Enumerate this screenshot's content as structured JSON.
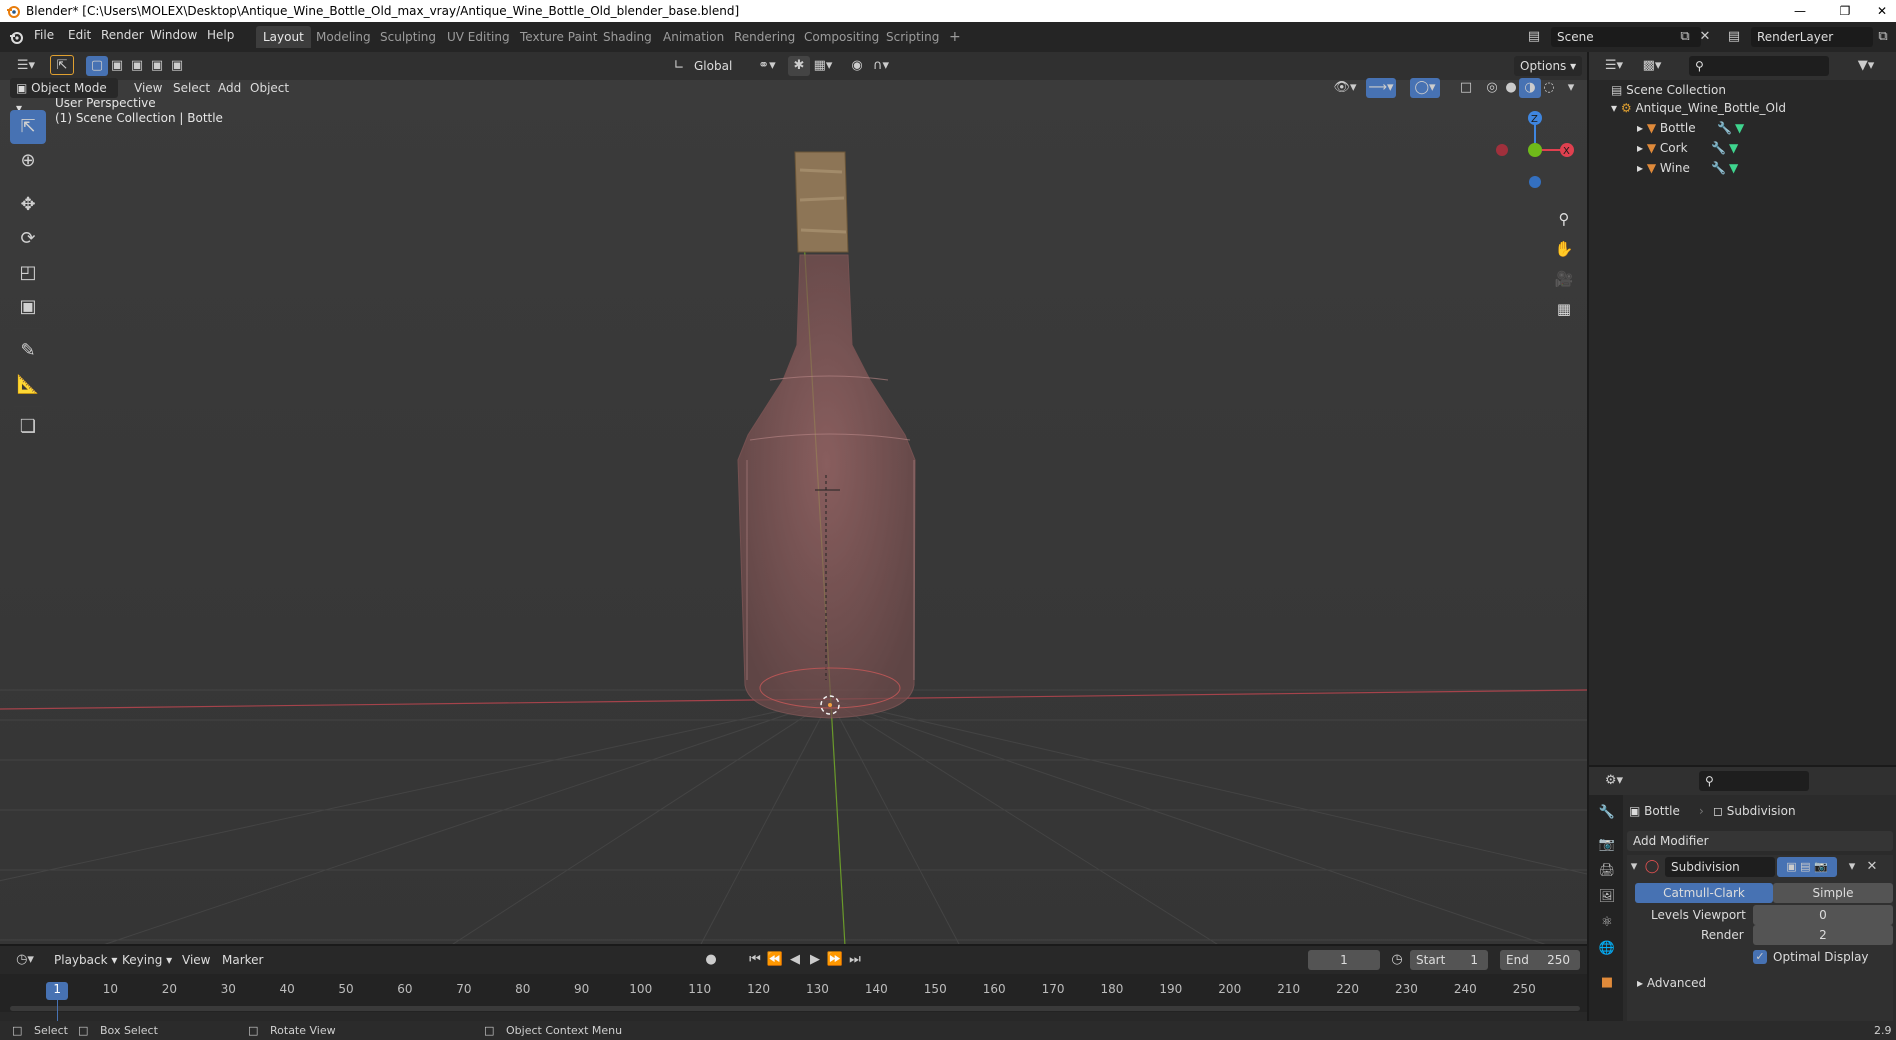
{
  "window": {
    "title": "Blender* [C:\\Users\\MOLEX\\Desktop\\Antique_Wine_Bottle_Old_max_vray/Antique_Wine_Bottle_Old_blender_base.blend]",
    "minimize": "—",
    "restore": "❐",
    "close": "✕"
  },
  "menu": [
    "File",
    "Edit",
    "Render",
    "Window",
    "Help"
  ],
  "workspaces": [
    "Layout",
    "Modeling",
    "Sculpting",
    "UV Editing",
    "Texture Paint",
    "Shading",
    "Animation",
    "Rendering",
    "Compositing",
    "Scripting"
  ],
  "workspace_add": "+",
  "scene": {
    "name": "Scene",
    "render_layer": "RenderLayer"
  },
  "viewport_header": {
    "transform_orientation": "Global",
    "options": "Options",
    "mode": "Object Mode",
    "menus": [
      "View",
      "Select",
      "Add",
      "Object"
    ]
  },
  "viewport": {
    "perspective": "User Perspective",
    "collection_info": "(1) Scene Collection | Bottle",
    "axes": {
      "z": "Z",
      "x": "X"
    }
  },
  "outliner": {
    "root": "Scene Collection",
    "collection": "Antique_Wine_Bottle_Old",
    "objects": [
      "Bottle",
      "Cork",
      "Wine"
    ]
  },
  "properties": {
    "object": "Bottle",
    "modifier_name": "Subdivision",
    "add_modifier": "Add Modifier",
    "mode_catmull": "Catmull-Clark",
    "mode_simple": "Simple",
    "levels_viewport_label": "Levels Viewport",
    "levels_viewport_value": "0",
    "render_label": "Render",
    "render_value": "2",
    "optimal_display": "Optimal Display",
    "advanced": "Advanced"
  },
  "timeline": {
    "menus": [
      "Playback",
      "Keying",
      "View",
      "Marker"
    ],
    "current_frame": "1",
    "start_label": "Start",
    "start": "1",
    "end_label": "End",
    "end": "250",
    "ruler": [
      "1",
      "10",
      "20",
      "30",
      "40",
      "50",
      "60",
      "70",
      "80",
      "90",
      "100",
      "110",
      "120",
      "130",
      "140",
      "150",
      "160",
      "170",
      "180",
      "190",
      "200",
      "210",
      "220",
      "230",
      "240",
      "250"
    ]
  },
  "statusbar": {
    "select": "Select",
    "box_select": "Box Select",
    "rotate_view": "Rotate View",
    "context_menu": "Object Context Menu",
    "version": "2.9"
  },
  "colors": {
    "accent": "#4772b3",
    "x_axis": "#e0404f",
    "y_axis": "#6fba1a",
    "z_axis": "#3f86e0",
    "object_icon": "#e08a3a"
  }
}
